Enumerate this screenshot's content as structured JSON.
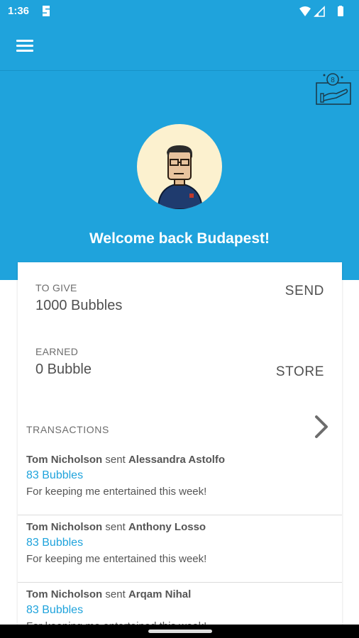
{
  "status_bar": {
    "time": "1:36"
  },
  "header": {
    "menu_icon": "hamburger-menu-icon",
    "gift_icon": "hand-coin-icon"
  },
  "hero": {
    "welcome_text": "Welcome back Budapest!",
    "avatar": "avatar-man-glasses"
  },
  "balances": {
    "to_give": {
      "label": "TO GIVE",
      "value": "1000 Bubbles",
      "action": "SEND"
    },
    "earned": {
      "label": "EARNED",
      "value": "0 Bubble",
      "action": "STORE"
    }
  },
  "transactions": {
    "title": "TRANSACTIONS",
    "items": [
      {
        "sender": "Tom Nicholson",
        "verb": "sent",
        "receiver": "Alessandra Astolfo",
        "amount": "83 Bubbles",
        "message": "For keeping me entertained this week!"
      },
      {
        "sender": "Tom Nicholson",
        "verb": "sent",
        "receiver": "Anthony Losso",
        "amount": "83 Bubbles",
        "message": "For keeping me entertained this week!"
      },
      {
        "sender": "Tom Nicholson",
        "verb": "sent",
        "receiver": "Arqam Nihal",
        "amount": "83 Bubbles",
        "message": "For keeping me entertained this week!"
      }
    ]
  },
  "colors": {
    "primary": "#1fa3dc",
    "text": "#555555"
  }
}
